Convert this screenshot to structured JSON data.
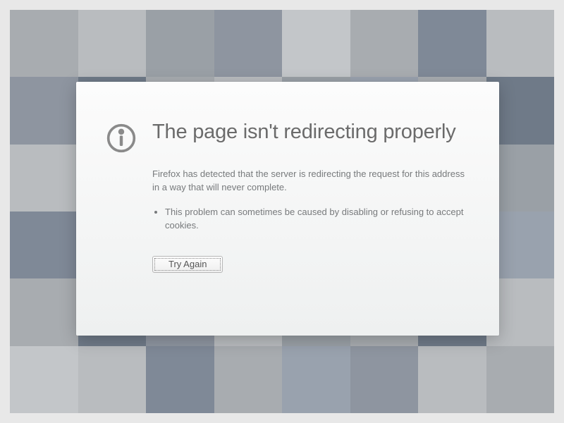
{
  "error": {
    "icon": "info-icon",
    "title": "The page isn't redirecting properly",
    "description": "Firefox has detected that the server is redirecting the request for this address in a way that will never complete.",
    "bullets": [
      "This problem can sometimes be caused by disabling or refusing to accept cookies."
    ],
    "try_again_label": "Try Again"
  }
}
